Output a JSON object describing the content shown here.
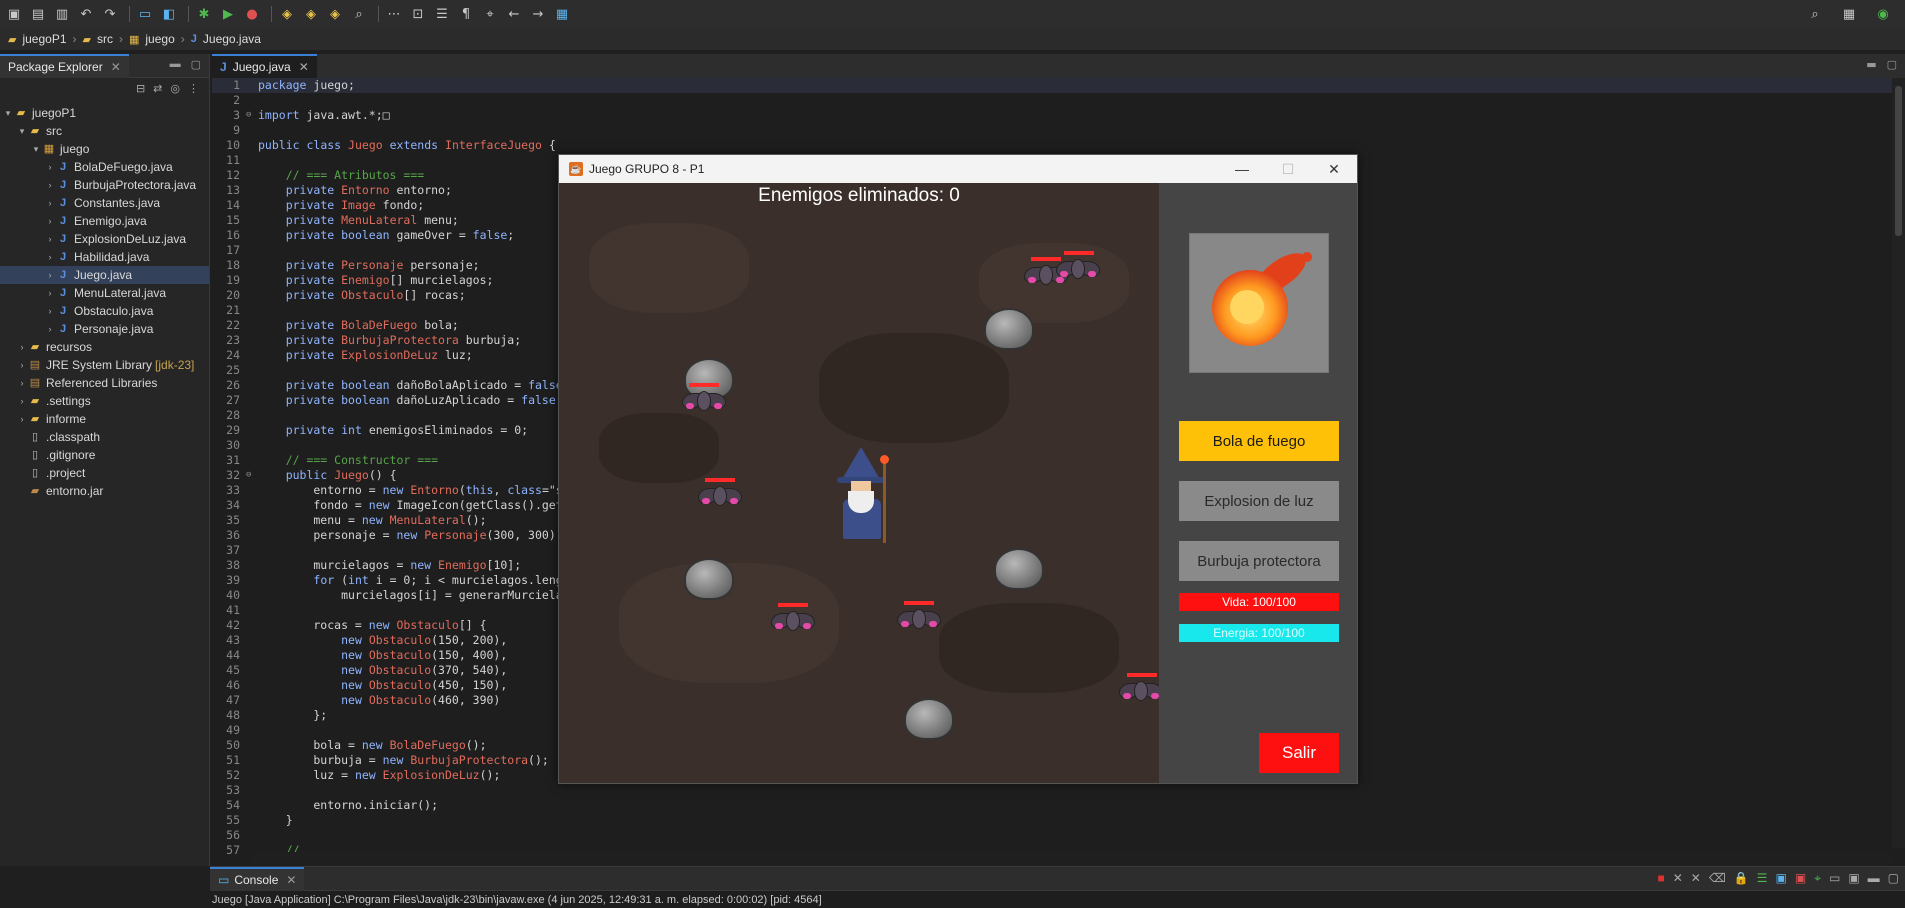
{
  "colors": {
    "accent": "#3b82d6",
    "game_title_bar": "#f3f3f3",
    "bola_button": "#ffc107",
    "vida_bar": "#ff1010",
    "energia_bar": "#18e8ec",
    "salir_button": "#ff1010",
    "enemy_health": "#ff2a2a"
  },
  "breadcrumb": {
    "project": "juegoP1",
    "folder": "src",
    "package": "juego",
    "file": "Juego.java"
  },
  "package_explorer": {
    "title": "Package Explorer",
    "tree": [
      {
        "label": "juegoP1",
        "depth": 0,
        "icon": "project-folder-icon",
        "expanded": true
      },
      {
        "label": "src",
        "depth": 1,
        "icon": "source-folder-icon",
        "expanded": true
      },
      {
        "label": "juego",
        "depth": 2,
        "icon": "package-icon",
        "expanded": true
      },
      {
        "label": "BolaDeFuego.java",
        "depth": 3,
        "icon": "java-file-icon"
      },
      {
        "label": "BurbujaProtectora.java",
        "depth": 3,
        "icon": "java-file-icon"
      },
      {
        "label": "Constantes.java",
        "depth": 3,
        "icon": "java-file-icon"
      },
      {
        "label": "Enemigo.java",
        "depth": 3,
        "icon": "java-file-icon"
      },
      {
        "label": "ExplosionDeLuz.java",
        "depth": 3,
        "icon": "java-file-icon"
      },
      {
        "label": "Habilidad.java",
        "depth": 3,
        "icon": "java-file-icon"
      },
      {
        "label": "Juego.java",
        "depth": 3,
        "icon": "java-file-icon",
        "selected": true
      },
      {
        "label": "MenuLateral.java",
        "depth": 3,
        "icon": "java-file-icon"
      },
      {
        "label": "Obstaculo.java",
        "depth": 3,
        "icon": "java-file-icon"
      },
      {
        "label": "Personaje.java",
        "depth": 3,
        "icon": "java-file-icon"
      },
      {
        "label": "recursos",
        "depth": 1,
        "icon": "folder-icon",
        "collapsed": true
      },
      {
        "label": "JRE System Library",
        "extra": "[jdk-23]",
        "depth": 1,
        "icon": "library-icon",
        "collapsed": true
      },
      {
        "label": "Referenced Libraries",
        "depth": 1,
        "icon": "library-icon",
        "collapsed": true
      },
      {
        "label": ".settings",
        "depth": 1,
        "icon": "folder-icon",
        "collapsed": true
      },
      {
        "label": "informe",
        "depth": 1,
        "icon": "folder-icon",
        "collapsed": true
      },
      {
        "label": ".classpath",
        "depth": 1,
        "icon": "file-icon"
      },
      {
        "label": ".gitignore",
        "depth": 1,
        "icon": "file-icon"
      },
      {
        "label": ".project",
        "depth": 1,
        "icon": "file-icon"
      },
      {
        "label": "entorno.jar",
        "depth": 1,
        "icon": "jar-icon"
      }
    ]
  },
  "editor": {
    "tab": "Juego.java",
    "lines": [
      {
        "n": "1",
        "t": "package juego;",
        "hl": true
      },
      {
        "n": "2",
        "t": ""
      },
      {
        "n": "3",
        "t": "import java.awt.*;□",
        "fold": true
      },
      {
        "n": "9",
        "t": ""
      },
      {
        "n": "10",
        "t": "public class Juego extends InterfaceJuego {"
      },
      {
        "n": "11",
        "t": ""
      },
      {
        "n": "12",
        "t": "    // === Atributos ==="
      },
      {
        "n": "13",
        "t": "    private Entorno entorno;"
      },
      {
        "n": "14",
        "t": "    private Image fondo;"
      },
      {
        "n": "15",
        "t": "    private MenuLateral menu;"
      },
      {
        "n": "16",
        "t": "    private boolean gameOver = false;"
      },
      {
        "n": "17",
        "t": ""
      },
      {
        "n": "18",
        "t": "    private Personaje personaje;"
      },
      {
        "n": "19",
        "t": "    private Enemigo[] murcielagos;"
      },
      {
        "n": "20",
        "t": "    private Obstaculo[] rocas;"
      },
      {
        "n": "21",
        "t": ""
      },
      {
        "n": "22",
        "t": "    private BolaDeFuego bola;"
      },
      {
        "n": "23",
        "t": "    private BurbujaProtectora burbuja;"
      },
      {
        "n": "24",
        "t": "    private ExplosionDeLuz luz;"
      },
      {
        "n": "25",
        "t": ""
      },
      {
        "n": "26",
        "t": "    private boolean dañoBolaAplicado = false"
      },
      {
        "n": "27",
        "t": "    private boolean dañoLuzAplicado = false"
      },
      {
        "n": "28",
        "t": ""
      },
      {
        "n": "29",
        "t": "    private int enemigosEliminados = 0;"
      },
      {
        "n": "30",
        "t": ""
      },
      {
        "n": "31",
        "t": "    // === Constructor ==="
      },
      {
        "n": "32",
        "t": "    public Juego() {",
        "fold": true
      },
      {
        "n": "33",
        "t": "        entorno = new Entorno(this, \"Juego G"
      },
      {
        "n": "34",
        "t": "        fondo = new ImageIcon(getClass().get"
      },
      {
        "n": "35",
        "t": "        menu = new MenuLateral();"
      },
      {
        "n": "36",
        "t": "        personaje = new Personaje(300, 300)"
      },
      {
        "n": "37",
        "t": ""
      },
      {
        "n": "38",
        "t": "        murcielagos = new Enemigo[10];"
      },
      {
        "n": "39",
        "t": "        for (int i = 0; i < murcielagos.leng"
      },
      {
        "n": "40",
        "t": "            murcielagos[i] = generarMurciela"
      },
      {
        "n": "41",
        "t": ""
      },
      {
        "n": "42",
        "t": "        rocas = new Obstaculo[] {"
      },
      {
        "n": "43",
        "t": "            new Obstaculo(150, 200),"
      },
      {
        "n": "44",
        "t": "            new Obstaculo(150, 400),"
      },
      {
        "n": "45",
        "t": "            new Obstaculo(370, 540),"
      },
      {
        "n": "46",
        "t": "            new Obstaculo(450, 150),"
      },
      {
        "n": "47",
        "t": "            new Obstaculo(460, 390)"
      },
      {
        "n": "48",
        "t": "        };"
      },
      {
        "n": "49",
        "t": ""
      },
      {
        "n": "50",
        "t": "        bola = new BolaDeFuego();"
      },
      {
        "n": "51",
        "t": "        burbuja = new BurbujaProtectora();"
      },
      {
        "n": "52",
        "t": "        luz = new ExplosionDeLuz();"
      },
      {
        "n": "53",
        "t": ""
      },
      {
        "n": "54",
        "t": "        entorno.iniciar();"
      },
      {
        "n": "55",
        "t": "    }"
      },
      {
        "n": "56",
        "t": ""
      },
      {
        "n": "57",
        "t": "    // ..."
      }
    ]
  },
  "console": {
    "title": "Console",
    "status": "Juego [Java Application] C:\\Program Files\\Java\\jdk-23\\bin\\javaw.exe  (4 jun 2025, 12:49:31 a. m. elapsed: 0:00:02) [pid: 4564]"
  },
  "game_window": {
    "title": "Juego GRUPO 8 - P1",
    "counter": "Enemigos eliminados: 0",
    "buttons": {
      "bola": "Bola de fuego",
      "luz": "Explosion de luz",
      "burbuja": "Burbuja protectora",
      "salir": "Salir"
    },
    "vida": "Vida: 100/100",
    "energia": "Energia: 100/100"
  }
}
